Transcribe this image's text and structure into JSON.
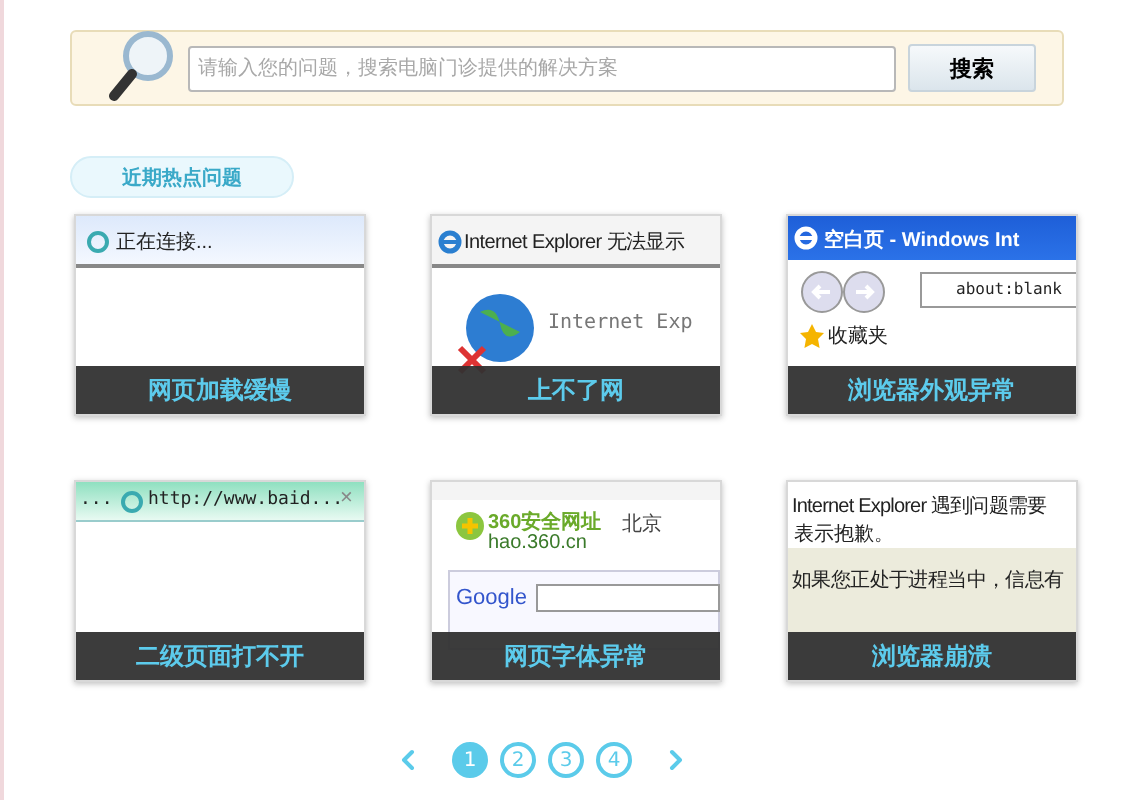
{
  "search": {
    "placeholder": "请输入您的问题，搜索电脑门诊提供的解决方案",
    "button": "搜索"
  },
  "hot_label": "近期热点问题",
  "cards": [
    {
      "caption": "网页加载缓慢",
      "kind": "loading",
      "texts": [
        "正在连接..."
      ]
    },
    {
      "caption": "上不了网",
      "kind": "offline",
      "texts": [
        "Internet Explorer 无法显示",
        "Internet Exp"
      ]
    },
    {
      "caption": "浏览器外观异常",
      "kind": "window",
      "texts": [
        "空白页 - Windows Int",
        "about:blank",
        "收藏夹"
      ]
    },
    {
      "caption": "二级页面打不开",
      "kind": "tabs",
      "texts": [
        "...",
        "http://www.baid...",
        "×"
      ]
    },
    {
      "caption": "网页字体异常",
      "kind": "homepage",
      "texts": [
        "360安全网址",
        "hao.360.cn",
        "北京",
        "Google"
      ]
    },
    {
      "caption": "浏览器崩溃",
      "kind": "crash",
      "texts": [
        "Internet Explorer 遇到问题需要",
        "表示抱歉。",
        "如果您正处于进程当中，信息有"
      ]
    }
  ],
  "pagination": {
    "pages": [
      {
        "label": "1",
        "selected": true
      },
      {
        "label": "2",
        "selected": false
      },
      {
        "label": "3",
        "selected": false
      },
      {
        "label": "4",
        "selected": false
      }
    ]
  }
}
